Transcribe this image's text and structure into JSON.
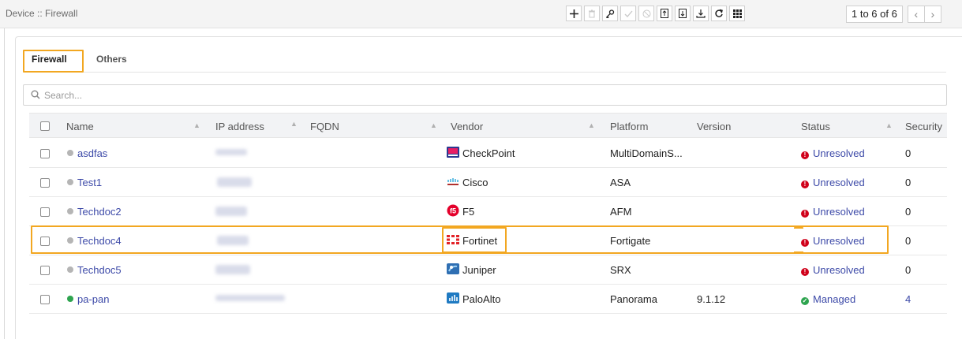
{
  "header": {
    "breadcrumb": "Device :: Firewall",
    "toolbar": {
      "icons": [
        "add-icon",
        "delete-icon",
        "key-icon",
        "check-icon",
        "disable-icon",
        "import-icon",
        "export-icon",
        "download-icon",
        "refresh-icon",
        "grid-icon"
      ]
    },
    "pager": {
      "label": "1 to 6 of 6",
      "prev": "‹",
      "next": "›"
    }
  },
  "tabs": [
    {
      "label": "Firewall",
      "active": true
    },
    {
      "label": "Others",
      "active": false
    }
  ],
  "search": {
    "placeholder": "Search..."
  },
  "table": {
    "columns": [
      "Name",
      "IP address",
      "FQDN",
      "Vendor",
      "Platform",
      "Version",
      "Status",
      "Security"
    ],
    "rows": [
      {
        "name": "asdfas",
        "status_dot": "#b5b5b5",
        "ip": "10.1.1.1",
        "vendor": "CheckPoint",
        "vendor_icon": "checkpoint-icon",
        "platform": "MultiDomainS...",
        "version": "",
        "status": "Unresolved",
        "security": "0"
      },
      {
        "name": "Test1",
        "status_dot": "#b5b5b5",
        "ip": "",
        "vendor": "Cisco",
        "vendor_icon": "cisco-icon",
        "platform": "ASA",
        "version": "",
        "status": "Unresolved",
        "security": "0"
      },
      {
        "name": "Techdoc2",
        "status_dot": "#b5b5b5",
        "ip": "",
        "vendor": "F5",
        "vendor_icon": "f5-icon",
        "platform": "AFM",
        "version": "",
        "status": "Unresolved",
        "security": "0"
      },
      {
        "name": "Techdoc4",
        "status_dot": "#b5b5b5",
        "ip": "",
        "vendor": "Fortinet",
        "vendor_icon": "fortinet-icon",
        "platform": "Fortigate",
        "version": "",
        "status": "Unresolved",
        "security": "0"
      },
      {
        "name": "Techdoc5",
        "status_dot": "#b5b5b5",
        "ip": "",
        "vendor": "Juniper",
        "vendor_icon": "juniper-icon",
        "platform": "SRX",
        "version": "",
        "status": "Unresolved",
        "security": "0"
      },
      {
        "name": "pa-pan",
        "status_dot": "#2ea44f",
        "ip": "192.168.17.10",
        "vendor": "PaloAlto",
        "vendor_icon": "paloalto-icon",
        "platform": "Panorama",
        "version": "9.1.12",
        "status": "Managed",
        "security": "4"
      }
    ]
  },
  "colors": {
    "highlight": "#f2a721",
    "link": "#3d4aa8",
    "unresolved": "#d0021b",
    "managed": "#2ea44f"
  }
}
